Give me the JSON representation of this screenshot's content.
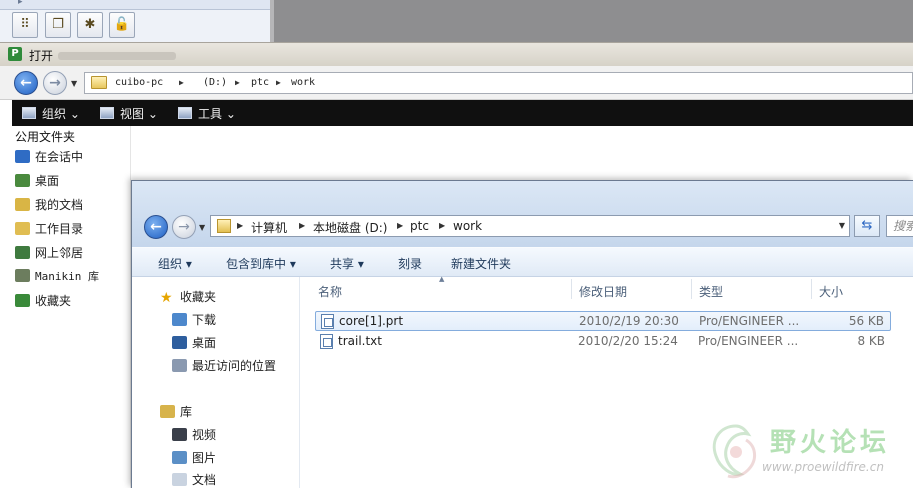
{
  "dialog_old": {
    "title": "打开",
    "path": [
      "cuibo-pc",
      "(D:)",
      "ptc",
      "work"
    ],
    "toolbar": [
      {
        "label": "组织",
        "icon": "organize-icon"
      },
      {
        "label": "视图",
        "icon": "views-icon"
      },
      {
        "label": "工具",
        "icon": "tools-icon"
      }
    ],
    "sidebar_header": "公用文件夹",
    "sidebar": [
      {
        "label": "在会话中",
        "icon": "session-icon",
        "color": "#2f6cc4"
      },
      {
        "label": "桌面",
        "icon": "desktop-icon",
        "color": "#4a8a3e"
      },
      {
        "label": "我的文档",
        "icon": "documents-icon",
        "color": "#d9b545"
      },
      {
        "label": "工作目录",
        "icon": "work-folder-icon",
        "color": "#e0bd52"
      },
      {
        "label": "网上邻居",
        "icon": "network-icon",
        "color": "#3f7a3f"
      },
      {
        "label": "Manikin 库",
        "icon": "manikin-library-icon",
        "color": "#6c7d5e"
      },
      {
        "label": "收藏夹",
        "icon": "favorites-icon",
        "color": "#3a8a3a"
      }
    ]
  },
  "explorer": {
    "path": [
      "计算机",
      "本地磁盘 (D:)",
      "ptc",
      "work"
    ],
    "search_placeholder": "搜索",
    "toolbar": [
      "组织",
      "包含到库中",
      "共享",
      "刻录",
      "新建文件夹"
    ],
    "nav": [
      {
        "label": "收藏夹",
        "icon": "favorites-star-icon",
        "group": true
      },
      {
        "label": "下载",
        "icon": "downloads-icon"
      },
      {
        "label": "桌面",
        "icon": "desktop-icon"
      },
      {
        "label": "最近访问的位置",
        "icon": "recent-places-icon"
      },
      {
        "label": "库",
        "icon": "libraries-icon",
        "group": true
      },
      {
        "label": "视频",
        "icon": "videos-icon"
      },
      {
        "label": "图片",
        "icon": "pictures-icon"
      },
      {
        "label": "文档",
        "icon": "documents-icon"
      }
    ],
    "columns": [
      "名称",
      "修改日期",
      "类型",
      "大小"
    ],
    "files": [
      {
        "name": "core[1].prt",
        "date": "2010/2/19 20:30",
        "type": "Pro/ENGINEER ...",
        "size": "56 KB",
        "selected": true
      },
      {
        "name": "trail.txt",
        "date": "2010/2/20 15:24",
        "type": "Pro/ENGINEER ...",
        "size": "8 KB",
        "selected": false
      }
    ]
  },
  "watermark": {
    "text": "野火论坛",
    "url": "www.proewildfire.cn"
  }
}
